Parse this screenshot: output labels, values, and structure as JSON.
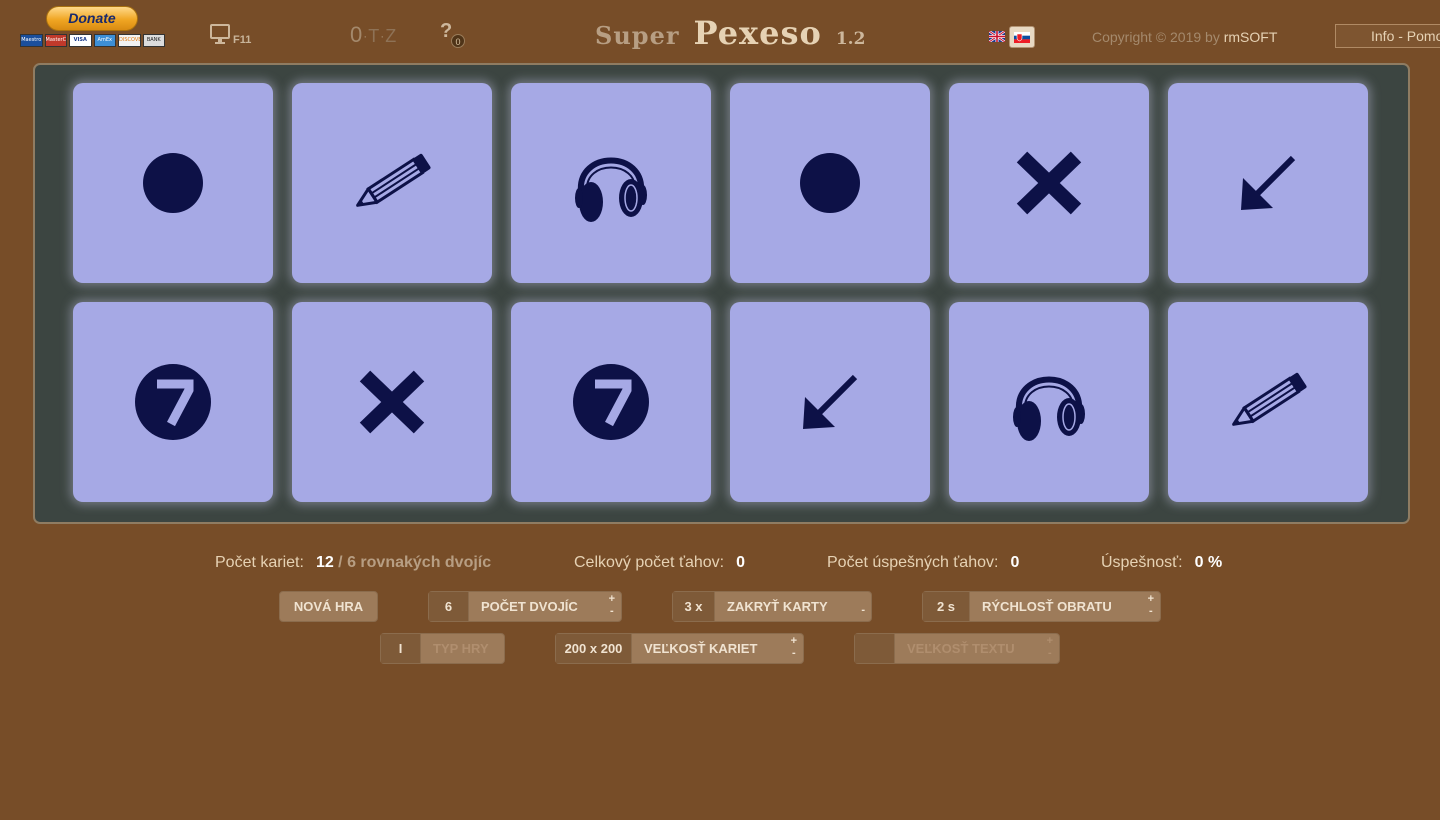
{
  "header": {
    "donate_label": "Donate",
    "payment_cards": [
      "Maestro",
      "MasterCard",
      "VISA",
      "AmEx",
      "DISCOVER",
      "BANK"
    ],
    "fullscreen_key": "F11",
    "otz": {
      "o": "0",
      "t": "T",
      "z": "Z"
    },
    "help_label": "?",
    "help_count": "0",
    "title_small": "Super",
    "title_main": "Pexeso",
    "version": "1.2",
    "languages": [
      "English",
      "Slovensky"
    ],
    "copyright_prefix": "Copyright © 2019 by ",
    "copyright_brand": "rmSOFT",
    "info_label": "Info - Pomoc"
  },
  "board": {
    "cards": [
      {
        "symbol": "dot",
        "text": ""
      },
      {
        "symbol": "pencil",
        "text": ""
      },
      {
        "symbol": "headphones",
        "text": ""
      },
      {
        "symbol": "dot",
        "text": ""
      },
      {
        "symbol": "cross",
        "text": ""
      },
      {
        "symbol": "arrow-down-left",
        "text": ""
      },
      {
        "symbol": "seven",
        "text": "7"
      },
      {
        "symbol": "cross",
        "text": ""
      },
      {
        "symbol": "seven",
        "text": "7"
      },
      {
        "symbol": "arrow-down-left",
        "text": ""
      },
      {
        "symbol": "headphones",
        "text": ""
      },
      {
        "symbol": "pencil",
        "text": ""
      }
    ],
    "colors": {
      "card": "#a6a9e5",
      "symbol": "#0d1147",
      "board": "#3c4541"
    }
  },
  "stats": {
    "cards_label": "Počet kariet:",
    "cards_value": "12",
    "cards_sep": " / ",
    "pairs_text": "6 rovnakých dvojíc",
    "moves_label": "Celkový počet ťahov:",
    "moves_value": "0",
    "success_moves_label": "Počet úspešných ťahov:",
    "success_moves_value": "0",
    "success_rate_label": "Úspešnosť:",
    "success_rate_value": "0 %"
  },
  "controls": {
    "new_game": "NOVÁ HRA",
    "pairs": {
      "value": "6",
      "label": "POČET DVOJÍC",
      "plus": "+",
      "minus": "-"
    },
    "hide_cards": {
      "value": "3 x",
      "label": "ZAKRYŤ KARTY",
      "minus": "-"
    },
    "flip_speed": {
      "value": "2 s",
      "label": "RÝCHLOSŤ OBRATU",
      "plus": "+",
      "minus": "-"
    },
    "game_type": {
      "value": "I",
      "label": "TYP HRY"
    },
    "card_size": {
      "value": "200 x 200",
      "label": "VEĽKOSŤ KARIET",
      "plus": "+",
      "minus": "-"
    },
    "text_size": {
      "value": "",
      "label": "VEĽKOSŤ TEXTU",
      "plus": "+",
      "minus": "-"
    }
  }
}
